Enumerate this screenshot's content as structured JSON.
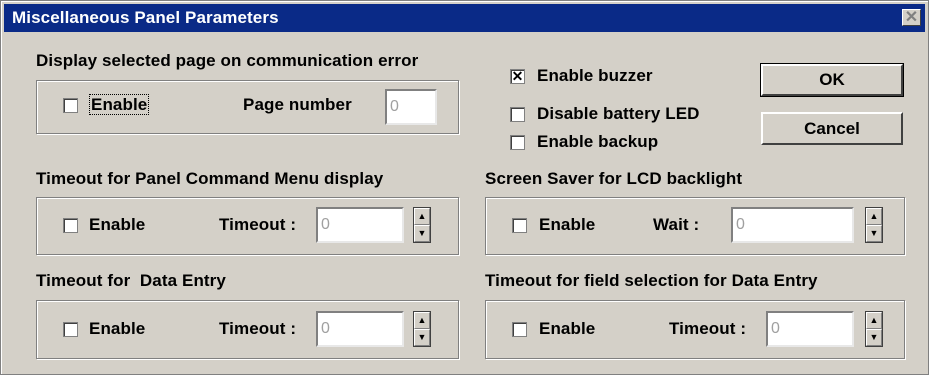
{
  "window": {
    "title": "Miscellaneous Panel Parameters",
    "close_glyph": "✕"
  },
  "comm_error": {
    "heading": "Display selected page on communication error",
    "enable_label": "Enable",
    "enable_checked": false,
    "page_number_label": "Page number",
    "page_number_value": "0"
  },
  "options": {
    "enable_buzzer": {
      "label": "Enable buzzer",
      "checked": true
    },
    "disable_battery_led": {
      "label": "Disable battery LED",
      "checked": false
    },
    "enable_backup": {
      "label": "Enable backup",
      "checked": false
    }
  },
  "buttons": {
    "ok_label": "OK",
    "cancel_label": "Cancel"
  },
  "command_menu": {
    "heading": "Timeout for Panel Command Menu display",
    "enable_label": "Enable",
    "timeout_label": "Timeout :",
    "timeout_value": "0"
  },
  "screen_saver": {
    "heading": "Screen Saver for LCD backlight",
    "enable_label": "Enable",
    "wait_label": "Wait :",
    "wait_value": "0"
  },
  "data_entry": {
    "heading": "Timeout for  Data Entry",
    "enable_label": "Enable",
    "timeout_label": "Timeout :",
    "timeout_value": "0"
  },
  "field_selection": {
    "heading": "Timeout for field selection for Data Entry",
    "enable_label": "Enable",
    "timeout_label": "Timeout :",
    "timeout_value": "0"
  },
  "checkmark_glyph": "✕",
  "colors": {
    "titlebar": "#0a2a87",
    "face": "#d4d0c8"
  }
}
